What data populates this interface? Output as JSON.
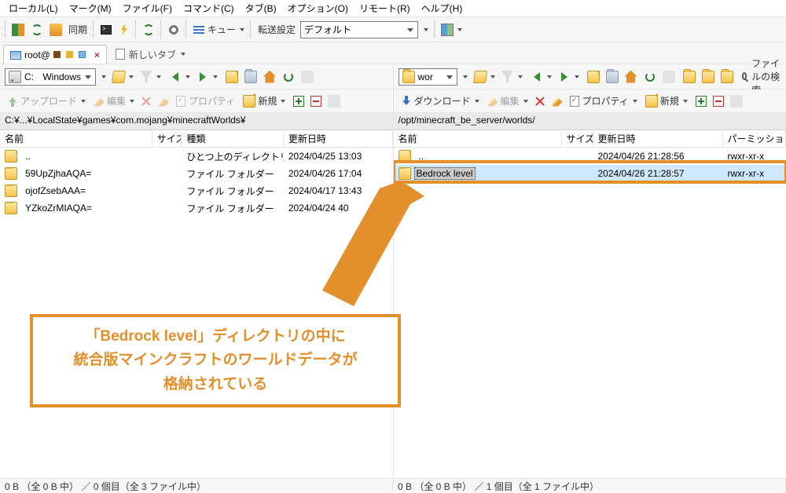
{
  "menu": {
    "local": "ローカル(L)",
    "mark": "マーク(M)",
    "file": "ファイル(F)",
    "command": "コマンド(C)",
    "tab": "タブ(B)",
    "option": "オプション(O)",
    "remote": "リモート(R)",
    "help": "ヘルプ(H)"
  },
  "toolbar1": {
    "sync": "同期",
    "queue": "キュー",
    "transfer_settings": "転送設定",
    "transfer_preset": "デフォルト"
  },
  "tabs": {
    "session": "root@",
    "newtab": "新しいタブ"
  },
  "drives": {
    "local": {
      "name": "C:",
      "label": "Windows"
    },
    "remote": {
      "name": "wor"
    }
  },
  "remote_search": "ファイルの検索",
  "actions": {
    "upload": "アップロード",
    "download": "ダウンロード",
    "edit": "編集",
    "props": "プロパティ",
    "new": "新規"
  },
  "paths": {
    "local": "C:¥...¥LocalState¥games¥com.mojang¥minecraftWorlds¥",
    "remote": "/opt/minecraft_be_server/worlds/"
  },
  "columns": {
    "name": "名前",
    "size": "サイズ",
    "type": "種類",
    "date": "更新日時",
    "perm": "パーミッション"
  },
  "local_rows": [
    {
      "name": "..",
      "type": "ひとつ上のディレクトリ",
      "date": "2024/04/25 13:03",
      "up": true
    },
    {
      "name": "59UpZjhaAQA=",
      "type": "ファイル フォルダー",
      "date": "2024/04/26 17:04"
    },
    {
      "name": "ojofZsebAAA=",
      "type": "ファイル フォルダー",
      "date": "2024/04/17 13:43"
    },
    {
      "name": "YZkoZrMIAQA=",
      "type": "ファイル フォルダー",
      "date": "2024/04/24    40"
    }
  ],
  "remote_rows": [
    {
      "name": "..",
      "date": "2024/04/26 21:28:56",
      "perm": "rwxr-xr-x",
      "up": true
    },
    {
      "name": "Bedrock level",
      "date": "2024/04/26 21:28:57",
      "perm": "rwxr-xr-x",
      "selected": true
    }
  ],
  "status": {
    "local": "0 B （全 0 B 中） ／ 0 個目（全 3 ファイル中）",
    "remote": "0 B （全 0 B 中） ／ 1 個目（全 1 ファイル中）"
  },
  "callout": {
    "line1": "「Bedrock level」ディレクトリの中に",
    "line2": "統合版マインクラフトのワールドデータが",
    "line3": "格納されている"
  },
  "colors": {
    "accent": "#e28f2c"
  }
}
